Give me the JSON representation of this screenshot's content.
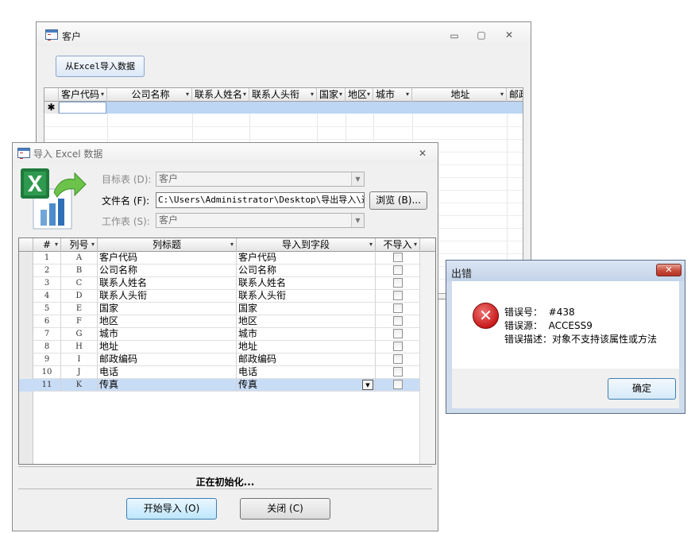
{
  "customer_window": {
    "title": "客户",
    "controls": {
      "minimize": "▭",
      "maximize": "▢",
      "close": "✕"
    },
    "import_button": "从Excel导入数据",
    "grid_columns": [
      "客户代码",
      "公司名称",
      "联系人姓名",
      "联系人头衔",
      "国家",
      "地区",
      "城市",
      "地址",
      "邮政"
    ],
    "new_record_marker": "✱"
  },
  "import_window": {
    "title": "导入 Excel 数据",
    "close": "✕",
    "target_table_label": "目标表 (D):",
    "target_table_value": "客户",
    "file_name_label": "文件名 (F):",
    "file_name_value": "C:\\Users\\Administrator\\Desktop\\导出导入\\通用",
    "browse_button": "浏览 (B)...",
    "worksheet_label": "工作表 (S):",
    "worksheet_value": "客户",
    "grid": {
      "columns": [
        "#",
        "列号",
        "列标题",
        "导入到字段",
        "不导入"
      ],
      "rows": [
        {
          "num": "1",
          "col": "A",
          "title": "客户代码",
          "field": "客户代码"
        },
        {
          "num": "2",
          "col": "B",
          "title": "公司名称",
          "field": "公司名称"
        },
        {
          "num": "3",
          "col": "C",
          "title": "联系人姓名",
          "field": "联系人姓名"
        },
        {
          "num": "4",
          "col": "D",
          "title": "联系人头衔",
          "field": "联系人头衔"
        },
        {
          "num": "5",
          "col": "E",
          "title": "国家",
          "field": "国家"
        },
        {
          "num": "6",
          "col": "F",
          "title": "地区",
          "field": "地区"
        },
        {
          "num": "7",
          "col": "G",
          "title": "城市",
          "field": "城市"
        },
        {
          "num": "8",
          "col": "H",
          "title": "地址",
          "field": "地址"
        },
        {
          "num": "9",
          "col": "I",
          "title": "邮政编码",
          "field": "邮政编码"
        },
        {
          "num": "10",
          "col": "J",
          "title": "电话",
          "field": "电话"
        },
        {
          "num": "11",
          "col": "K",
          "title": "传真",
          "field": "传真"
        }
      ]
    },
    "status": "正在初始化...",
    "start_button": "开始导入 (O)",
    "close_button": "关闭 (C)"
  },
  "error_dialog": {
    "title": "出错",
    "close": "✕",
    "error_number_label": "错误号：",
    "error_number": "#438",
    "error_source_label": "错误源：",
    "error_source": "ACCESS9",
    "error_desc": "错误描述：对象不支持该属性或方法",
    "ok_button": "确定"
  },
  "colors": {
    "selection": "#c9dcf5",
    "new_row": "#bcd6f3",
    "error_red": "#c81a1a",
    "primary_border": "#3c7fb1"
  }
}
